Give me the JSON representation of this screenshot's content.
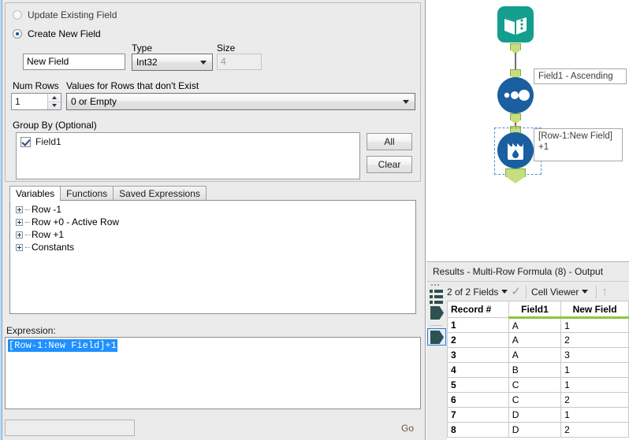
{
  "config": {
    "update_existing_label": "Update Existing Field",
    "create_new_label": "Create New  Field",
    "update_existing_selected": false,
    "create_new_selected": true,
    "new_field_value": "New Field",
    "type_label": "Type",
    "type_value": "Int32",
    "size_label": "Size",
    "size_value": "4",
    "num_rows_label": "Num Rows",
    "num_rows_value": "1",
    "values_missing_label": "Values for Rows that don't Exist",
    "values_missing_value": "0 or Empty",
    "group_by_label": "Group By (Optional)",
    "group_by_items": [
      {
        "label": "Field1",
        "checked": true
      }
    ],
    "all_button": "All",
    "clear_button": "Clear"
  },
  "tabs": [
    {
      "label": "Variables",
      "active": true
    },
    {
      "label": "Functions",
      "active": false
    },
    {
      "label": "Saved Expressions",
      "active": false
    }
  ],
  "variables_tree": [
    {
      "label": "Row -1"
    },
    {
      "label": "Row +0 - Active Row"
    },
    {
      "label": "Row +1"
    },
    {
      "label": "Constants"
    }
  ],
  "expression": {
    "label": "Expression:",
    "text": "[Row-1:New Field]+1",
    "selected": true
  },
  "footer": {
    "go_label": "Go"
  },
  "canvas": {
    "nodes": [
      {
        "name": "input-data",
        "icon": "book-icon",
        "color": "#149e8d"
      },
      {
        "name": "sort",
        "icon": "sort-dots-icon",
        "color": "#1a5fa0"
      },
      {
        "name": "multi-row-formula",
        "icon": "beaker-droplet-icon",
        "color": "#1a5fa0",
        "selected": true
      }
    ],
    "annotations": [
      {
        "text": "Field1 - Ascending"
      },
      {
        "text": "[Row-1:New Field]\n+1"
      }
    ]
  },
  "results": {
    "title": "Results - Multi-Row Formula (8) - Output",
    "fields_selector": "2 of 2 Fields",
    "viewer_selector": "Cell Viewer",
    "columns": [
      "Record #",
      "Field1",
      "New Field"
    ],
    "rows": [
      [
        "1",
        "A",
        "1"
      ],
      [
        "2",
        "A",
        "2"
      ],
      [
        "3",
        "A",
        "3"
      ],
      [
        "4",
        "B",
        "1"
      ],
      [
        "5",
        "C",
        "1"
      ],
      [
        "6",
        "C",
        "2"
      ],
      [
        "7",
        "D",
        "1"
      ],
      [
        "8",
        "D",
        "2"
      ]
    ]
  },
  "colors": {
    "accent_green": "#8cc63f",
    "node_teal": "#149e8d",
    "node_blue": "#1a5fa0",
    "selection_blue": "#1e90ff",
    "error_red": "#e03b2f"
  }
}
